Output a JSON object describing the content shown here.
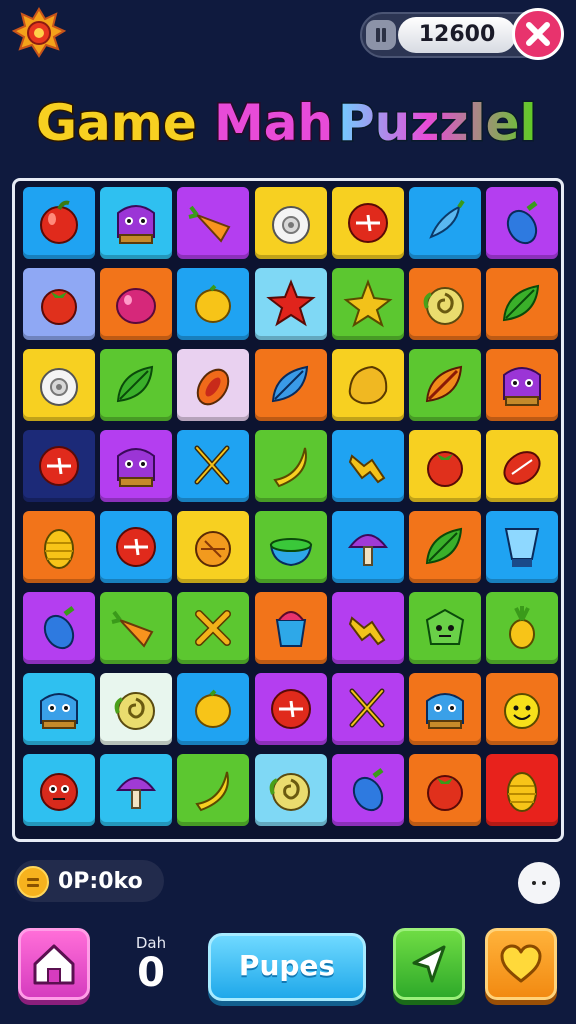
{
  "header": {
    "score": "12600",
    "title_words": [
      "Game",
      "Mah",
      "Puzzlel"
    ]
  },
  "board": {
    "columns": 7,
    "rows": 8,
    "tiles": [
      {
        "bg": "#1fa3f2",
        "icon": "apple"
      },
      {
        "bg": "#2fc0f0",
        "icon": "purple-monster"
      },
      {
        "bg": "#b43ef0",
        "icon": "carrot"
      },
      {
        "bg": "#f7d021",
        "icon": "cauliflower"
      },
      {
        "bg": "#f7d021",
        "icon": "red-ball"
      },
      {
        "bg": "#1fa3f2",
        "icon": "blue-chili"
      },
      {
        "bg": "#b43ef0",
        "icon": "blue-eggplant"
      },
      {
        "bg": "#8fa8f4",
        "icon": "tomato"
      },
      {
        "bg": "#f2741a",
        "icon": "plum"
      },
      {
        "bg": "#1fa3f2",
        "icon": "lemon"
      },
      {
        "bg": "#7fd8f5",
        "icon": "red-star"
      },
      {
        "bg": "#5cc730",
        "icon": "starfruit"
      },
      {
        "bg": "#f2741a",
        "icon": "cabbage"
      },
      {
        "bg": "#f2741a",
        "icon": "green-leaf"
      },
      {
        "bg": "#f7d021",
        "icon": "cauliflower"
      },
      {
        "bg": "#5cc730",
        "icon": "green-leaf"
      },
      {
        "bg": "#e9d1f0",
        "icon": "papaya"
      },
      {
        "bg": "#f2741a",
        "icon": "blue-leaf"
      },
      {
        "bg": "#f7d021",
        "icon": "potato"
      },
      {
        "bg": "#5cc730",
        "icon": "brown-leaf"
      },
      {
        "bg": "#f2741a",
        "icon": "purple-monster"
      },
      {
        "bg": "#1c2a78",
        "icon": "red-ball"
      },
      {
        "bg": "#b43ef0",
        "icon": "purple-monster"
      },
      {
        "bg": "#1fa3f2",
        "icon": "utensils"
      },
      {
        "bg": "#5cc730",
        "icon": "banana"
      },
      {
        "bg": "#1fa3f2",
        "icon": "ginger"
      },
      {
        "bg": "#f7d021",
        "icon": "tomato"
      },
      {
        "bg": "#f7d021",
        "icon": "melon"
      },
      {
        "bg": "#f2741a",
        "icon": "corn"
      },
      {
        "bg": "#1fa3f2",
        "icon": "red-ball"
      },
      {
        "bg": "#f7d021",
        "icon": "onion"
      },
      {
        "bg": "#5cc730",
        "icon": "bowl"
      },
      {
        "bg": "#1fa3f2",
        "icon": "mushroom"
      },
      {
        "bg": "#f2741a",
        "icon": "green-leaf"
      },
      {
        "bg": "#1fa3f2",
        "icon": "blender"
      },
      {
        "bg": "#b43ef0",
        "icon": "blue-eggplant"
      },
      {
        "bg": "#5cc730",
        "icon": "carrot"
      },
      {
        "bg": "#5cc730",
        "icon": "crossed-sticks"
      },
      {
        "bg": "#f2741a",
        "icon": "cup"
      },
      {
        "bg": "#b43ef0",
        "icon": "ginger"
      },
      {
        "bg": "#5cc730",
        "icon": "green-monster"
      },
      {
        "bg": "#5cc730",
        "icon": "pineapple"
      },
      {
        "bg": "#2fc0f0",
        "icon": "blue-monster"
      },
      {
        "bg": "#e8f6ee",
        "icon": "cabbage"
      },
      {
        "bg": "#1fa3f2",
        "icon": "lemon"
      },
      {
        "bg": "#b43ef0",
        "icon": "red-ball"
      },
      {
        "bg": "#b43ef0",
        "icon": "utensils"
      },
      {
        "bg": "#f2741a",
        "icon": "blue-monster"
      },
      {
        "bg": "#f2741a",
        "icon": "yellow-smiley"
      },
      {
        "bg": "#2fc0f0",
        "icon": "red-monster"
      },
      {
        "bg": "#2fc0f0",
        "icon": "mushroom"
      },
      {
        "bg": "#5cc730",
        "icon": "banana"
      },
      {
        "bg": "#7fd8f5",
        "icon": "cabbage"
      },
      {
        "bg": "#b43ef0",
        "icon": "blue-eggplant"
      },
      {
        "bg": "#f2741a",
        "icon": "tomato"
      },
      {
        "bg": "#e8221c",
        "icon": "corn"
      }
    ]
  },
  "footer": {
    "coins": "0P:0ko",
    "stat_label": "Dah",
    "stat_value": "0",
    "main_button": "Pupes"
  },
  "colors": {
    "background": "#0f1a3e",
    "title_game": "#f7d021",
    "title_mah": "#e84bd8",
    "title_puzzle_start": "#6fd0ff",
    "title_puzzle_end": "#5cd020"
  }
}
